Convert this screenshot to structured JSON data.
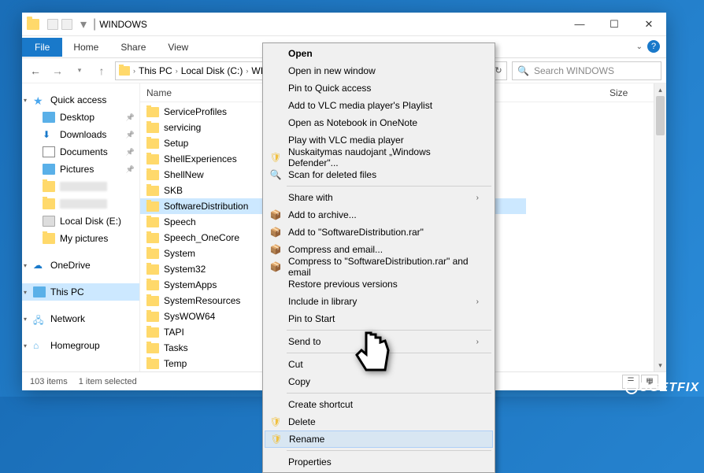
{
  "window": {
    "title": "WINDOWS"
  },
  "ribbon": {
    "file": "File",
    "home": "Home",
    "share": "Share",
    "view": "View"
  },
  "breadcrumb": {
    "this_pc": "This PC",
    "local_disk": "Local Disk (C:)",
    "windows": "WINDO"
  },
  "search": {
    "placeholder": "Search WINDOWS"
  },
  "columns": {
    "name": "Name",
    "size": "Size"
  },
  "navpane": {
    "quick_access": "Quick access",
    "desktop": "Desktop",
    "downloads": "Downloads",
    "documents": "Documents",
    "pictures": "Pictures",
    "local_disk_e": "Local Disk (E:)",
    "my_pictures": "My pictures",
    "onedrive": "OneDrive",
    "this_pc": "This PC",
    "network": "Network",
    "homegroup": "Homegroup"
  },
  "files": [
    "ServiceProfiles",
    "servicing",
    "Setup",
    "ShellExperiences",
    "ShellNew",
    "SKB",
    "SoftwareDistribution",
    "Speech",
    "Speech_OneCore",
    "System",
    "System32",
    "SystemApps",
    "SystemResources",
    "SysWOW64",
    "TAPI",
    "Tasks",
    "Temp"
  ],
  "selected_index": 6,
  "status": {
    "count": "103 items",
    "selection": "1 item selected"
  },
  "context_menu": {
    "open": "Open",
    "open_new": "Open in new window",
    "pin_quick": "Pin to Quick access",
    "vlc_playlist": "Add to VLC media player's Playlist",
    "onenote": "Open as Notebook in OneNote",
    "vlc_play": "Play with VLC media player",
    "defender": "Nuskaitymas naudojant „Windows Defender\"...",
    "scan_deleted": "Scan for deleted files",
    "share_with": "Share with",
    "add_archive": "Add to archive...",
    "add_rar": "Add to \"SoftwareDistribution.rar\"",
    "compress_email": "Compress and email...",
    "compress_rar_email": "Compress to \"SoftwareDistribution.rar\" and email",
    "restore": "Restore previous versions",
    "include_library": "Include in library",
    "pin_start": "Pin to Start",
    "send_to": "Send to",
    "cut": "Cut",
    "copy": "Copy",
    "create_shortcut": "Create shortcut",
    "delete": "Delete",
    "rename": "Rename",
    "properties": "Properties"
  }
}
